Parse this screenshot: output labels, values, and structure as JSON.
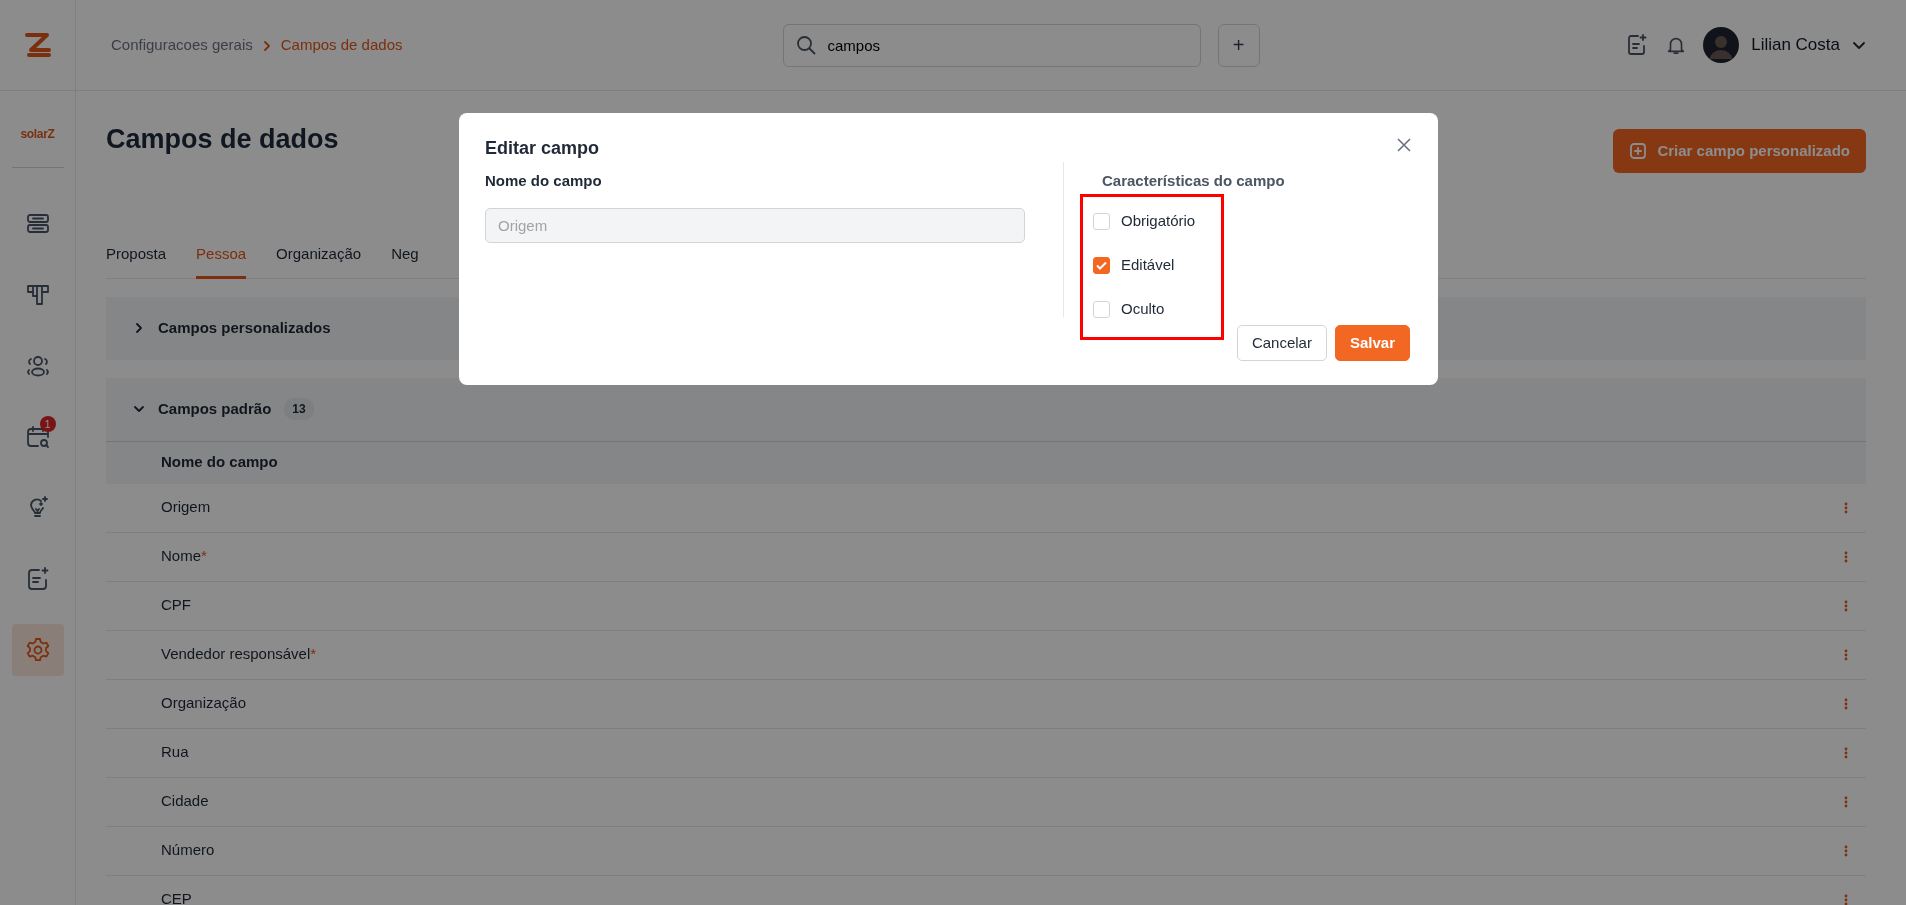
{
  "topbar": {
    "breadcrumb": [
      {
        "label": "Configuracoes gerais",
        "current": false
      },
      {
        "label": "Campos de dados",
        "current": true
      }
    ],
    "search": {
      "value": "campos"
    },
    "add_button": "+",
    "user": {
      "name": "Lilian Costa"
    }
  },
  "sidebar": {
    "brand": "solarZ",
    "items": [
      {
        "selected": false
      },
      {
        "selected": false
      },
      {
        "selected": false
      },
      {
        "selected": false,
        "badge": "1"
      },
      {
        "selected": false
      },
      {
        "selected": false
      },
      {
        "selected": true
      }
    ]
  },
  "page": {
    "title": "Campos de dados",
    "create_button": "Criar campo personalizado"
  },
  "tabs": [
    {
      "label": "Proposta",
      "selected": false
    },
    {
      "label": "Pessoa",
      "selected": true
    },
    {
      "label": "Organização",
      "selected": false
    },
    {
      "label": "Neg",
      "selected": false
    }
  ],
  "sections": [
    {
      "title": "Campos personalizados",
      "expanded": false
    },
    {
      "title": "Campos padrão",
      "count": "13",
      "expanded": true,
      "table": {
        "columns": [
          "Nome do campo"
        ],
        "rows": [
          {
            "name": "Origem"
          },
          {
            "name": "Nome",
            "required_mark": "*"
          },
          {
            "name": "CPF"
          },
          {
            "name": "Vendedor responsável",
            "required_mark": "*"
          },
          {
            "name": "Organização"
          },
          {
            "name": "Rua"
          },
          {
            "name": "Cidade"
          },
          {
            "name": "Número"
          },
          {
            "name": "CEP"
          }
        ]
      }
    }
  ],
  "dialog": {
    "title": "Editar campo",
    "field_label": "Nome do campo",
    "field": {
      "placeholder": "Origem",
      "disabled": true
    },
    "characteristics": {
      "title": "Características do campo",
      "highlighted": true,
      "options": [
        {
          "label": "Obrigatório",
          "checked": false
        },
        {
          "label": "Editável",
          "checked": true
        },
        {
          "label": "Oculto",
          "checked": false
        }
      ]
    },
    "buttons": [
      {
        "label": "Cancelar",
        "kind": "secondary"
      },
      {
        "label": "Salvar",
        "kind": "primary"
      }
    ]
  }
}
